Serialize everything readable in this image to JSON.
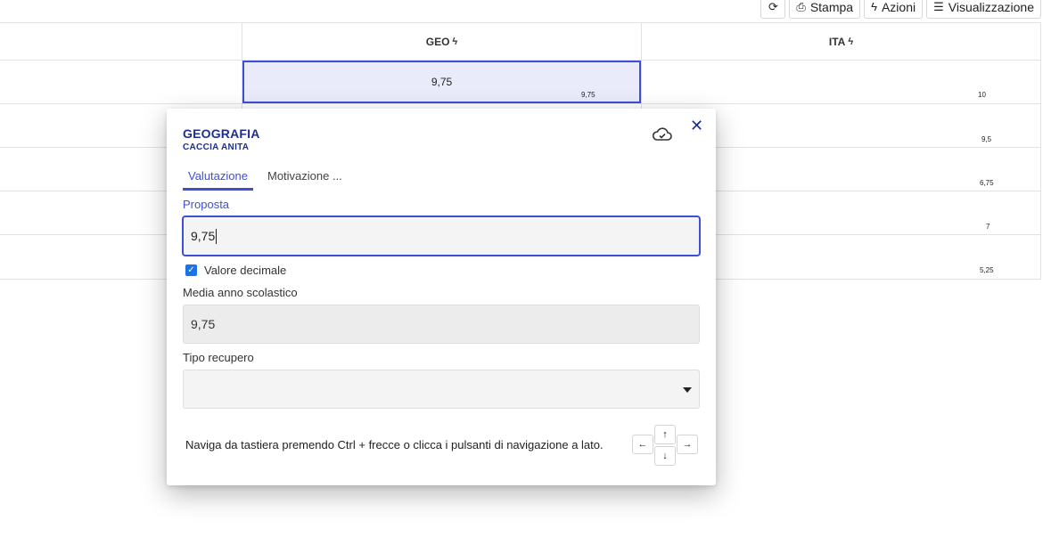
{
  "toolbar": {
    "refresh_icon": "refresh-icon",
    "print_label": "Stampa",
    "actions_label": "Azioni",
    "view_label": "Visualizzazione"
  },
  "table": {
    "columns": [
      {
        "label": ""
      },
      {
        "label": "GEO",
        "icon": "bolt-icon"
      },
      {
        "label": "ITA",
        "icon": "bolt-icon"
      }
    ],
    "rows": [
      {
        "geo_main": "9,75",
        "geo_sub": "9,75",
        "ita_sub": "10"
      },
      {
        "ita_sub": "9,5"
      },
      {
        "ita_sub": "6,75"
      },
      {
        "ita_sub": "7"
      },
      {
        "ita_sub": "5,25"
      }
    ]
  },
  "popup": {
    "title": "GEOGRAFIA",
    "subtitle": "CACCIA ANITA",
    "cloud_icon": "cloud-check-icon",
    "close_icon": "close-icon",
    "close_glyph": "✕",
    "tabs": [
      {
        "label": "Valutazione",
        "active": true
      },
      {
        "label": "Motivazione ..."
      }
    ],
    "proposta_label": "Proposta",
    "proposta_value": "9,75",
    "decimal_checkbox_label": "Valore decimale",
    "decimal_checked": true,
    "media_label": "Media anno scolastico",
    "media_value": "9,75",
    "recupero_label": "Tipo recupero",
    "recupero_value": "",
    "hint": "Naviga da tastiera premendo Ctrl + frecce o clicca i pulsanti di navigazione a lato.",
    "nav": {
      "left": "←",
      "up": "↑",
      "down": "↓",
      "right": "→"
    }
  },
  "colors": {
    "accent": "#3d4fd8",
    "title": "#1f2f8f",
    "selection_bg": "#e9ebfa"
  }
}
